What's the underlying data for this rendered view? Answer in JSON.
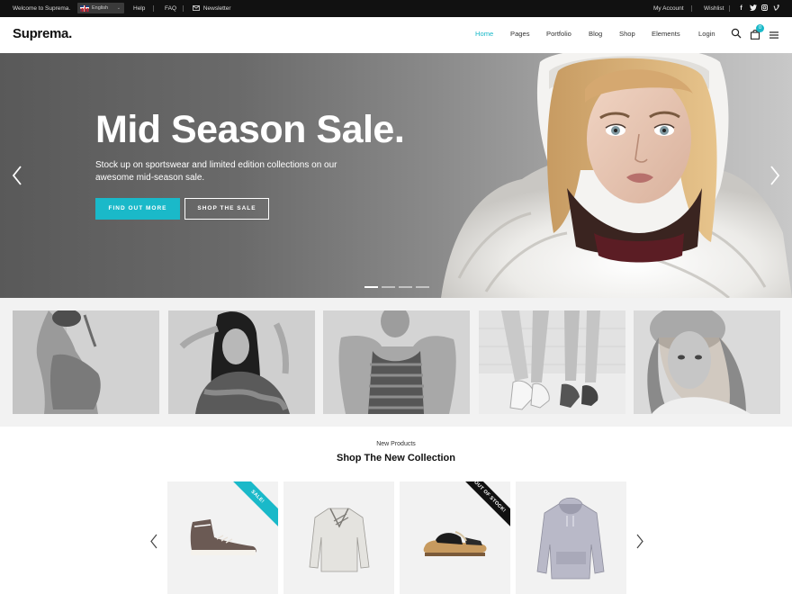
{
  "topbar": {
    "welcome": "Welcome to Suprema.",
    "language": "English",
    "help": "Help",
    "faq": "FAQ",
    "newsletter": "Newsletter",
    "my_account": "My Account",
    "wishlist": "Wishlist",
    "social_icons": [
      "facebook-icon",
      "twitter-icon",
      "instagram-icon",
      "vimeo-icon"
    ]
  },
  "header": {
    "logo": "Suprema.",
    "nav": [
      "Home",
      "Pages",
      "Portfolio",
      "Blog",
      "Shop",
      "Elements",
      "Login"
    ],
    "active_nav": "Home",
    "cart_count": "0"
  },
  "hero": {
    "title": "Mid Season Sale.",
    "subtitle": "Stock up on sportswear and limited edition collections on our awesome mid-season sale.",
    "primary_button": "FIND OUT MORE",
    "secondary_button": "SHOP THE SALE",
    "slide_count": 4,
    "active_slide": 1
  },
  "categories": [
    "model-1",
    "model-2",
    "model-3",
    "sneakers",
    "model-5"
  ],
  "products": {
    "label": "New Products",
    "title": "Shop The New Collection",
    "items": [
      {
        "name": "sneaker",
        "badge": "SALE!",
        "badge_color": "#1ab9c9"
      },
      {
        "name": "sweater",
        "badge": "",
        "badge_color": ""
      },
      {
        "name": "sandal",
        "badge": "OUT OF STOCK!",
        "badge_color": "#111111"
      },
      {
        "name": "hoodie",
        "badge": "",
        "badge_color": ""
      }
    ]
  },
  "colors": {
    "accent": "#1ab9c9",
    "topbar": "#111111"
  }
}
